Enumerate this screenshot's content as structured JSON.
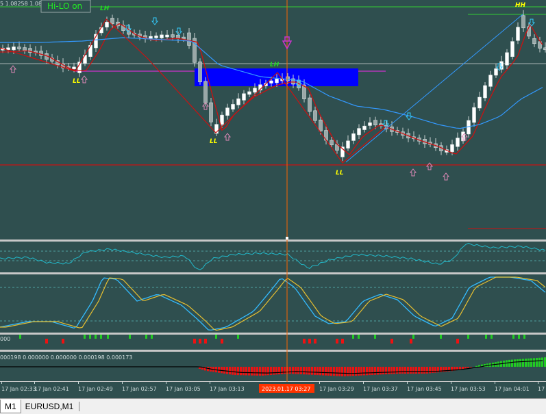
{
  "indicator_label": "Hi-LO on",
  "price_readout": "5 1.08258 1.0825",
  "price_chart": {
    "swing_labels": [
      {
        "text": "LH",
        "color": "#22dd22"
      },
      {
        "text": "LL",
        "color": "#ffff00"
      },
      {
        "text": "LL",
        "color": "#ffff00"
      },
      {
        "text": "LH",
        "color": "#22dd22"
      },
      {
        "text": "LL",
        "color": "#ffff00"
      },
      {
        "text": "HH",
        "color": "#ffff00"
      }
    ],
    "colors": {
      "background": "#2f4f4f",
      "bull_candle": "#ffffff",
      "bear_candle": "#9aa8a8",
      "ma_red": "#cc1111",
      "ma_blue": "#3399ff",
      "zone": "#0000ff",
      "crosshair": "#ff6600"
    }
  },
  "sub_window_1": {
    "level_label": "000"
  },
  "sub_window_2": {
    "values_text": "000198 0.000000 0.000000 0.000198 0.000173"
  },
  "time_axis": {
    "labels": [
      "17 Jan 02:33",
      "17 Jan 02:41",
      "17 Jan 02:49",
      "17 Jan 02:57",
      "17 Jan 03:05",
      "17 Jan 03:13",
      "17 Jan 03:29",
      "17 Jan 03:37",
      "17 Jan 03:45",
      "17 Jan 03:53",
      "17 Jan 04:01",
      "17 Jan 04:0"
    ],
    "crosshair_label": "2023.01.17 03:27"
  },
  "tabs": [
    {
      "label": "M1",
      "active": true
    },
    {
      "label": "EURUSD,M1",
      "active": false
    }
  ]
}
